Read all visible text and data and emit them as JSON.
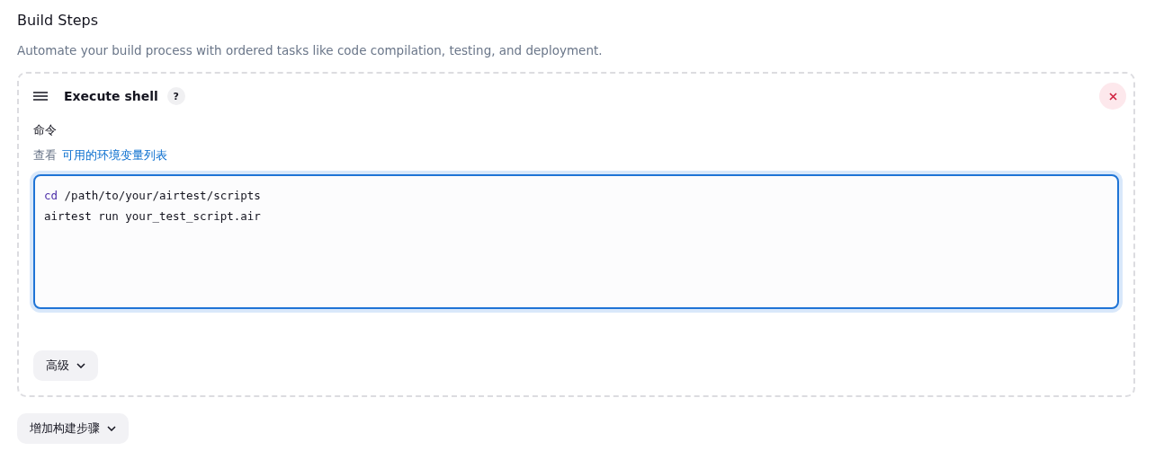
{
  "section": {
    "title": "Build Steps",
    "description": "Automate your build process with ordered tasks like code compilation, testing, and deployment."
  },
  "step": {
    "title": "Execute shell",
    "help": "?",
    "field_label": "命令",
    "env_hint": "查看",
    "env_link": "可用的环境变量列表",
    "code_lines": [
      {
        "tokens": [
          {
            "kind": "keyword",
            "text": "cd"
          },
          {
            "kind": "plain",
            "text": " /path/to/your/airtest/scripts"
          }
        ]
      },
      {
        "tokens": [
          {
            "kind": "plain",
            "text": "airtest run your_test_script.air"
          }
        ]
      }
    ],
    "advanced": "高级"
  },
  "add_step": "增加构建步骤"
}
